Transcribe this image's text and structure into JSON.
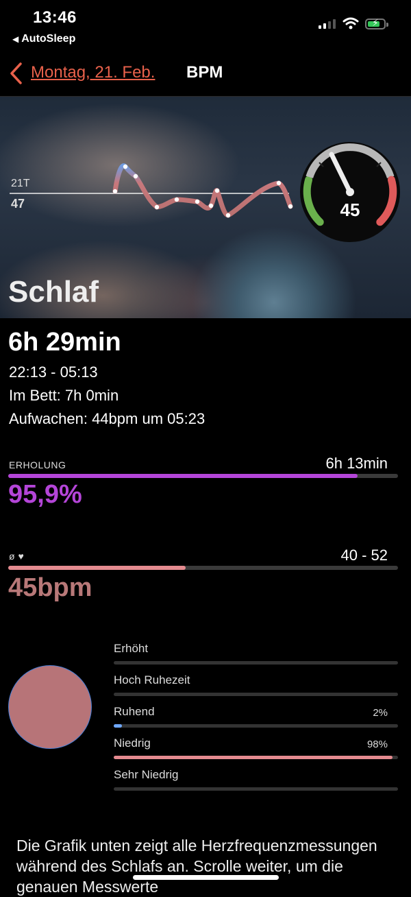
{
  "status_bar": {
    "time": "13:46",
    "back_app": "AutoSleep"
  },
  "nav": {
    "back_label": "Montag, 21. Feb.",
    "title": "BPM"
  },
  "hero": {
    "title": "Schlaf",
    "chart_top_label": "21T",
    "chart_bottom_label": "47",
    "gauge_value": "45"
  },
  "summary": {
    "duration": "6h 29min",
    "time_range": "22:13 - 05:13",
    "in_bed": "Im Bett: 7h 0min",
    "wake": "Aufwachen: 44bpm um 05:23"
  },
  "recovery": {
    "label": "ERHOLUNG",
    "right_value": "6h 13min",
    "percent_text": "95,9%",
    "fill_fraction": 0.896,
    "color": "#b445d8"
  },
  "heart": {
    "label": "ø ♥",
    "range": "40 - 52",
    "value_text": "45bpm",
    "fill_fraction": 0.455,
    "color": "#e48a8f"
  },
  "breakdown": [
    {
      "label": "Erhöht",
      "pct": "",
      "fill_fraction": 0,
      "color": "#e48a8f"
    },
    {
      "label": "Hoch Ruhezeit",
      "pct": "",
      "fill_fraction": 0,
      "color": "#e48a8f"
    },
    {
      "label": "Ruhend",
      "pct": "2%",
      "fill_fraction": 0.02,
      "color": "#6fa8ff"
    },
    {
      "label": "Niedrig",
      "pct": "98%",
      "fill_fraction": 0.98,
      "color": "#e48a8f"
    },
    {
      "label": "Sehr Niedrig",
      "pct": "",
      "fill_fraction": 0,
      "color": "#e48a8f"
    }
  ],
  "description": "Die Grafik unten zeigt alle Herzfrequenzmessungen während des Schlafs an. Scrolle weiter, um die genauen Messwerte"
}
